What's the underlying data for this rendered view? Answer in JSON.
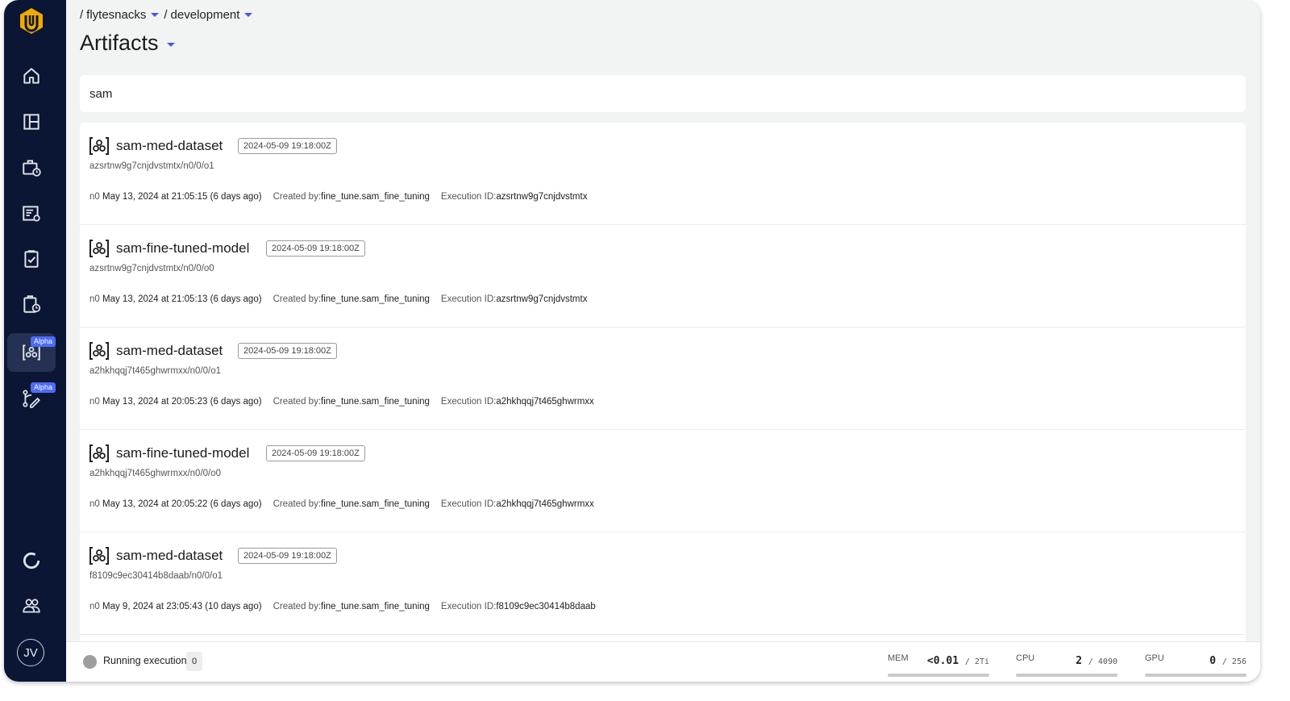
{
  "breadcrumb": {
    "project": "flytesnacks",
    "domain": "development"
  },
  "page_title": "Artifacts",
  "search": {
    "value": "sam"
  },
  "sidebar": {
    "items": [
      {
        "name": "home",
        "icon": "home-icon"
      },
      {
        "name": "dashboard",
        "icon": "layout-icon"
      },
      {
        "name": "launch-plans",
        "icon": "briefcase-clock-icon"
      },
      {
        "name": "tasks",
        "icon": "list-settings-icon"
      },
      {
        "name": "checklist",
        "icon": "clipboard-check-icon"
      },
      {
        "name": "schedules",
        "icon": "clipboard-clock-icon"
      },
      {
        "name": "artifacts",
        "icon": "artifact-icon",
        "badge": "Alpha",
        "active": true
      },
      {
        "name": "lineage",
        "icon": "branch-edit-icon",
        "badge": "Alpha"
      }
    ],
    "bottom": [
      {
        "name": "usage",
        "icon": "donut-icon"
      },
      {
        "name": "users",
        "icon": "users-icon"
      }
    ],
    "avatar": "JV"
  },
  "artifacts": [
    {
      "name": "sam-med-dataset",
      "version": "2024-05-09 19:18:00Z",
      "uri": "azsrtnw9g7cnjdvstmtx/n0/0/o1",
      "node": "n0",
      "created": "May 13, 2024 at 21:05:15 (6 days ago)",
      "created_by_label": "Created by:",
      "created_by": "fine_tune.sam_fine_tuning",
      "execution_label": "Execution ID:",
      "execution_id": "azsrtnw9g7cnjdvstmtx"
    },
    {
      "name": "sam-fine-tuned-model",
      "version": "2024-05-09 19:18:00Z",
      "uri": "azsrtnw9g7cnjdvstmtx/n0/0/o0",
      "node": "n0",
      "created": "May 13, 2024 at 21:05:13 (6 days ago)",
      "created_by_label": "Created by:",
      "created_by": "fine_tune.sam_fine_tuning",
      "execution_label": "Execution ID:",
      "execution_id": "azsrtnw9g7cnjdvstmtx"
    },
    {
      "name": "sam-med-dataset",
      "version": "2024-05-09 19:18:00Z",
      "uri": "a2hkhqqj7t465ghwrmxx/n0/0/o1",
      "node": "n0",
      "created": "May 13, 2024 at 20:05:23 (6 days ago)",
      "created_by_label": "Created by:",
      "created_by": "fine_tune.sam_fine_tuning",
      "execution_label": "Execution ID:",
      "execution_id": "a2hkhqqj7t465ghwrmxx"
    },
    {
      "name": "sam-fine-tuned-model",
      "version": "2024-05-09 19:18:00Z",
      "uri": "a2hkhqqj7t465ghwrmxx/n0/0/o0",
      "node": "n0",
      "created": "May 13, 2024 at 20:05:22 (6 days ago)",
      "created_by_label": "Created by:",
      "created_by": "fine_tune.sam_fine_tuning",
      "execution_label": "Execution ID:",
      "execution_id": "a2hkhqqj7t465ghwrmxx"
    },
    {
      "name": "sam-med-dataset",
      "version": "2024-05-09 19:18:00Z",
      "uri": "f8109c9ec30414b8daab/n0/0/o1",
      "node": "n0",
      "created": "May 9, 2024 at 23:05:43 (10 days ago)",
      "created_by_label": "Created by:",
      "created_by": "fine_tune.sam_fine_tuning",
      "execution_label": "Execution ID:",
      "execution_id": "f8109c9ec30414b8daab"
    }
  ],
  "footer": {
    "running_label": "Running executions",
    "running_count": "0",
    "resources": [
      {
        "label": "MEM",
        "used": "<0.01",
        "total": "/ 2Ti"
      },
      {
        "label": "CPU",
        "used": "2",
        "total": "/ 4090"
      },
      {
        "label": "GPU",
        "used": "0",
        "total": "/ 256"
      }
    ]
  },
  "colors": {
    "sidebar_bg": "#0a1633",
    "accent": "#4b57e0",
    "logo": "#f2a900",
    "alpha_badge": "#4b6cf5"
  }
}
